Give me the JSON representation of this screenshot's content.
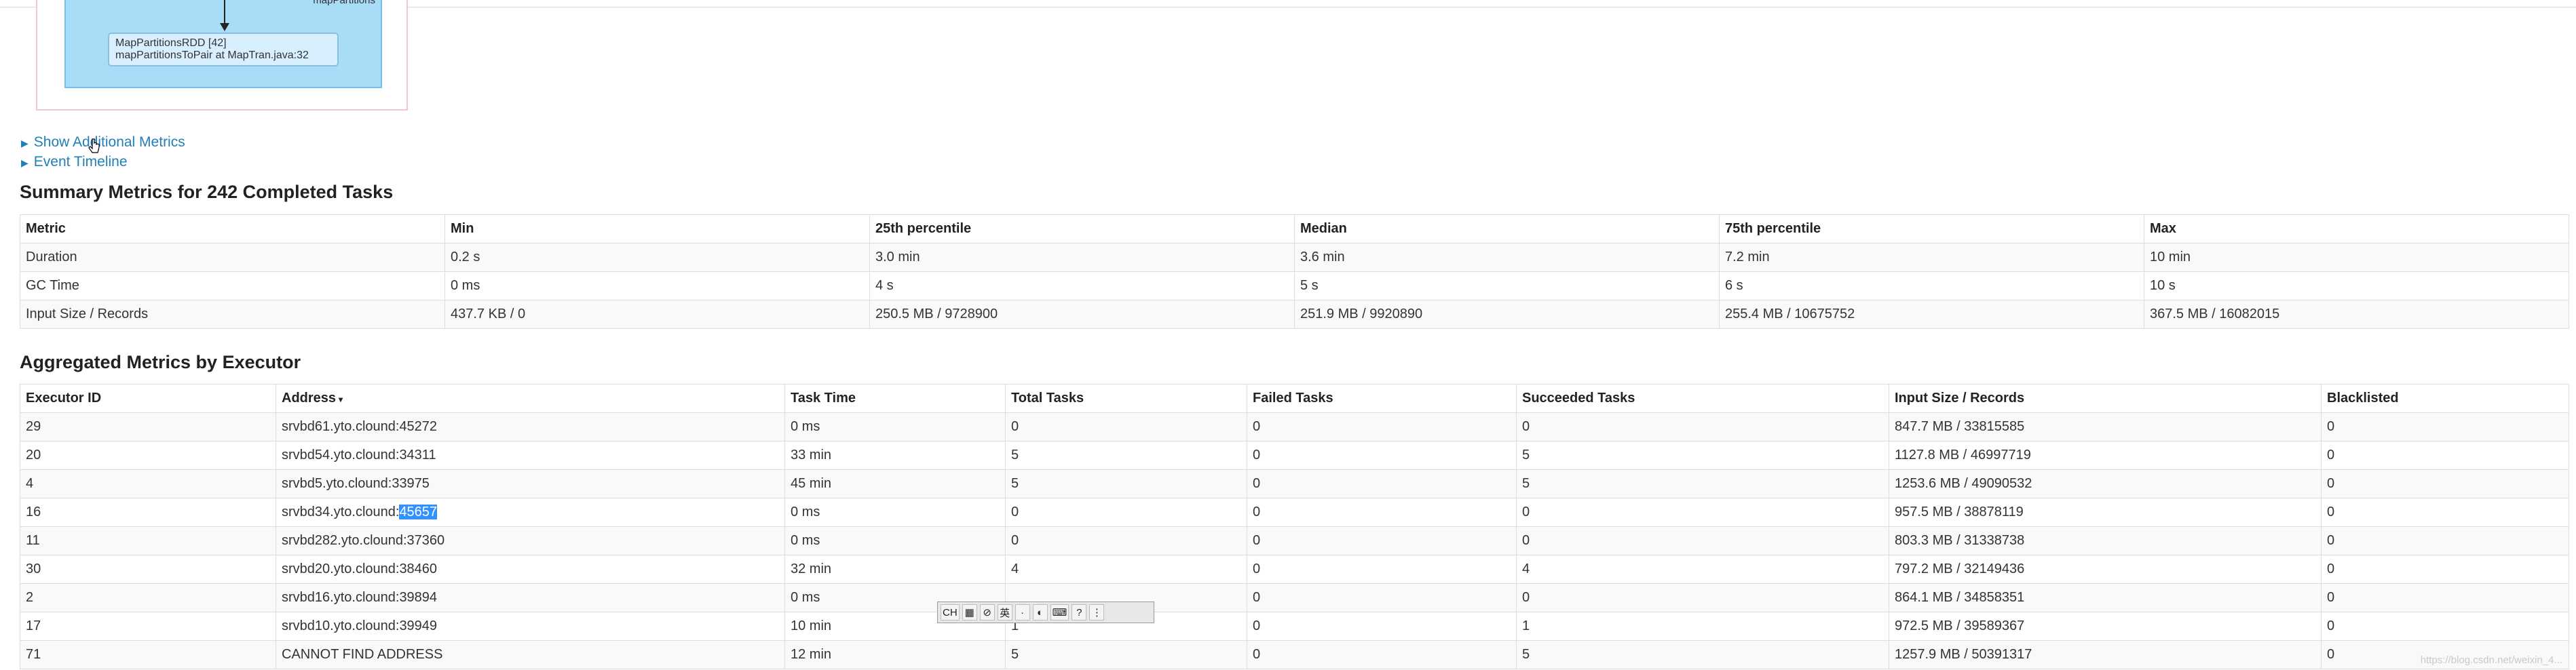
{
  "dag": {
    "stage_label": "mapPartitions",
    "node_line1": "MapPartitionsRDD [42]",
    "node_line2": "mapPartitionsToPair at MapTran.java:32"
  },
  "links": {
    "additional_metrics": "Show Additional Metrics",
    "event_timeline": "Event Timeline"
  },
  "summary": {
    "title": "Summary Metrics for 242 Completed Tasks",
    "headers": [
      "Metric",
      "Min",
      "25th percentile",
      "Median",
      "75th percentile",
      "Max"
    ],
    "rows": [
      [
        "Duration",
        "0.2 s",
        "3.0 min",
        "3.6 min",
        "7.2 min",
        "10 min"
      ],
      [
        "GC Time",
        "0 ms",
        "4 s",
        "5 s",
        "6 s",
        "10 s"
      ],
      [
        "Input Size / Records",
        "437.7 KB / 0",
        "250.5 MB / 9728900",
        "251.9 MB / 9920890",
        "255.4 MB / 10675752",
        "367.5 MB / 16082015"
      ]
    ]
  },
  "executors": {
    "title": "Aggregated Metrics by Executor",
    "headers": [
      "Executor ID",
      "Address",
      "Task Time",
      "Total Tasks",
      "Failed Tasks",
      "Succeeded Tasks",
      "Input Size / Records",
      "Blacklisted"
    ],
    "sort_indicator": "▾",
    "rows": [
      [
        "29",
        "srvbd61.yto.clound:45272",
        "0 ms",
        "0",
        "0",
        "0",
        "847.7 MB / 33815585",
        "0"
      ],
      [
        "20",
        "srvbd54.yto.clound:34311",
        "33 min",
        "5",
        "0",
        "5",
        "1127.8 MB / 46997719",
        "0"
      ],
      [
        "4",
        "srvbd5.yto.clound:33975",
        "45 min",
        "5",
        "0",
        "5",
        "1253.6 MB / 49090532",
        "0"
      ],
      [
        "16",
        "srvbd34.yto.clound:",
        "0 ms",
        "0",
        "0",
        "0",
        "957.5 MB / 38878119",
        "0"
      ],
      [
        "11",
        "srvbd282.yto.clound:37360",
        "0 ms",
        "0",
        "0",
        "0",
        "803.3 MB / 31338738",
        "0"
      ],
      [
        "30",
        "srvbd20.yto.clound:38460",
        "32 min",
        "4",
        "0",
        "4",
        "797.2 MB / 32149436",
        "0"
      ],
      [
        "2",
        "srvbd16.yto.clound:39894",
        "0 ms",
        "",
        "0",
        "0",
        "864.1 MB / 34858351",
        "0"
      ],
      [
        "17",
        "srvbd10.yto.clound:39949",
        "10 min",
        "1",
        "0",
        "1",
        "972.5 MB / 39589367",
        "0"
      ],
      [
        "71",
        "CANNOT FIND ADDRESS",
        "12 min",
        "5",
        "0",
        "5",
        "1257.9 MB / 50391317",
        "0"
      ]
    ],
    "selected_port": "45657"
  },
  "ime": {
    "items": [
      "CH",
      "▦",
      "⊘",
      "英",
      "·",
      "◐",
      "⌨",
      "?",
      "⋮"
    ]
  },
  "watermark": "https://blog.csdn.net/weixin_4..."
}
